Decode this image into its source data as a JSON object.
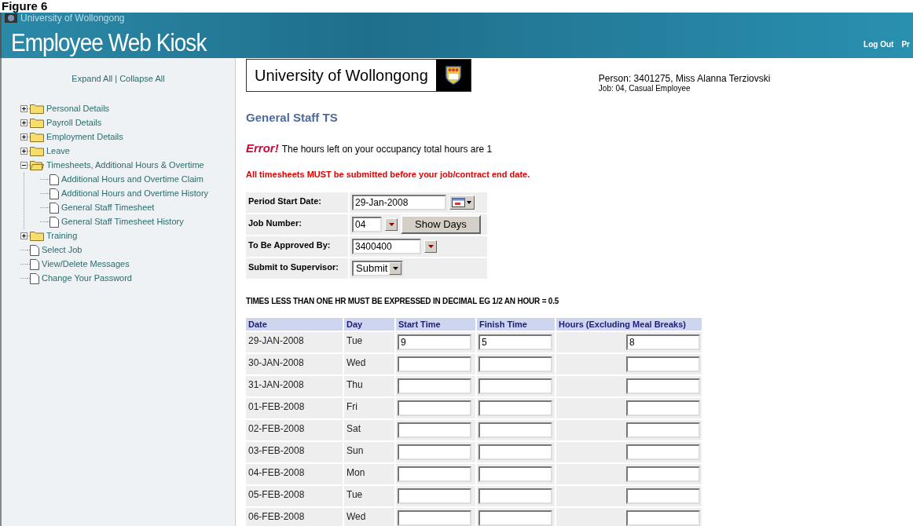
{
  "caption": "Figure 6",
  "header": {
    "org": "University of Wollongong",
    "title": "Employee Web Kiosk",
    "links": [
      "Log Out",
      "Pr"
    ]
  },
  "sidebar": {
    "expand_all": "Expand All",
    "separator": "|",
    "collapse_all": "Collapse All",
    "items": [
      {
        "label": "Personal Details",
        "kind": "folder",
        "expanded": false
      },
      {
        "label": "Payroll Details",
        "kind": "folder",
        "expanded": false
      },
      {
        "label": "Employment Details",
        "kind": "folder",
        "expanded": false
      },
      {
        "label": "Leave",
        "kind": "folder",
        "expanded": false
      },
      {
        "label": "Timesheets, Additional Hours & Overtime",
        "kind": "folder",
        "expanded": true,
        "children": [
          {
            "label": "Additional Hours and Overtime Claim",
            "kind": "page"
          },
          {
            "label": "Additional Hours and Overtime History",
            "kind": "page"
          },
          {
            "label": "General Staff Timesheet",
            "kind": "page"
          },
          {
            "label": "General Staff Timesheet History",
            "kind": "page"
          }
        ]
      },
      {
        "label": "Training",
        "kind": "folder",
        "expanded": false
      },
      {
        "label": "Select Job",
        "kind": "page"
      },
      {
        "label": "View/Delete Messages",
        "kind": "page"
      },
      {
        "label": "Change Your Password",
        "kind": "page"
      }
    ]
  },
  "main": {
    "logo_text": "University of Wollongong",
    "person": "Person: 3401275, Miss Alanna Terziovski",
    "job": "Job: 04, Casual Employee",
    "heading": "General Staff TS",
    "error": {
      "label": "Error!",
      "message": "The hours left on your occupancy total hours are 1"
    },
    "warning": "All timesheets MUST be submitted before your job/contract end date.",
    "form": [
      {
        "label": "Period Start Date:",
        "kind": "date",
        "value": "29-Jan-2008"
      },
      {
        "label": "Job Number:",
        "kind": "select_button",
        "value": "04",
        "button": "Show Days"
      },
      {
        "label": "To Be Approved By:",
        "kind": "select",
        "value": "3400400"
      },
      {
        "label": "Submit to Supervisor:",
        "kind": "dropdown",
        "value": "Submit"
      }
    ],
    "note": "TIMES LESS THAN ONE HR MUST BE EXPRESSED IN DECIMAL EG 1/2 AN HOUR = 0.5",
    "table": {
      "columns": [
        "Date",
        "Day",
        "Start Time",
        "Finish Time",
        "Hours (Excluding Meal Breaks)"
      ],
      "rows": [
        {
          "date": "29-JAN-2008",
          "day": "Tue",
          "start": "9",
          "finish": "5",
          "hours": "8"
        },
        {
          "date": "30-JAN-2008",
          "day": "Wed"
        },
        {
          "date": "31-JAN-2008",
          "day": "Thu"
        },
        {
          "date": "01-FEB-2008",
          "day": "Fri"
        },
        {
          "date": "02-FEB-2008",
          "day": "Sat"
        },
        {
          "date": "03-FEB-2008",
          "day": "Sun"
        },
        {
          "date": "04-FEB-2008",
          "day": "Mon"
        },
        {
          "date": "05-FEB-2008",
          "day": "Tue"
        },
        {
          "date": "06-FEB-2008",
          "day": "Wed"
        }
      ]
    }
  }
}
